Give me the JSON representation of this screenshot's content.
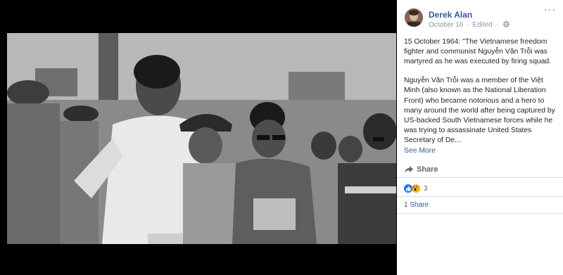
{
  "post": {
    "author": "Derek Alan",
    "date": "October 16",
    "separator": "·",
    "edited": "Edited",
    "edited_separator": "·",
    "more_options": "···",
    "paragraph1": "15 October 1964: \"The Vietnamese freedom fighter and communist Nguyễn Văn Trỗi was martyred as he was executed by firing squad.",
    "paragraph2": "Nguyễn Văn Trỗi was a member of the Việt Minh (also known as the National Liberation Front) who became notorious and a hero to many around the world after being captured by US-backed South Vietnamese forces while he was trying to assassinate United States Secretary of De...",
    "see_more": "See More"
  },
  "actions": {
    "share_label": "Share"
  },
  "reactions": {
    "count": "3",
    "types": [
      "like-icon",
      "wow-icon"
    ]
  },
  "shares": {
    "label": "1 Share"
  },
  "colors": {
    "link": "#385898",
    "viewer_bg": "#000000",
    "muted": "#90949c"
  }
}
